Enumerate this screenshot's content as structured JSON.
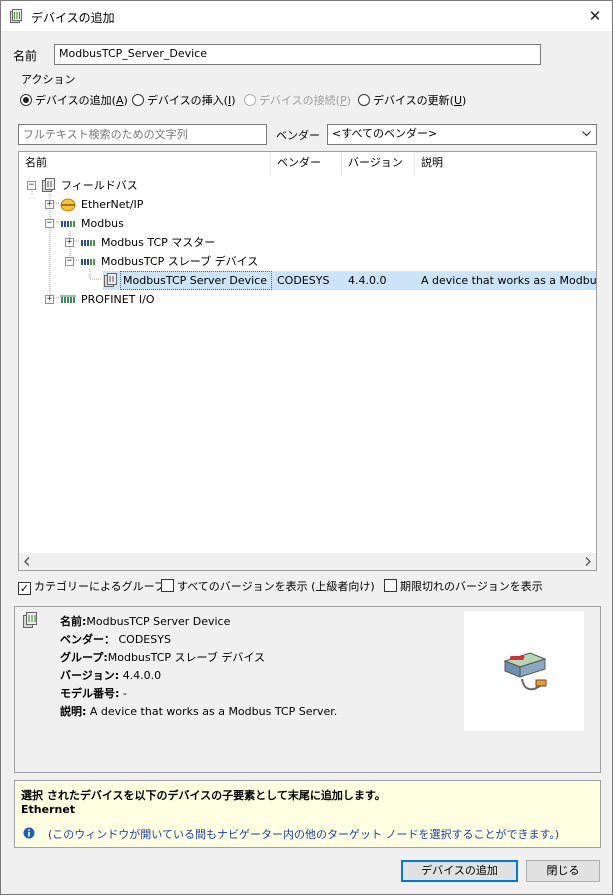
{
  "window": {
    "title": "デバイスの追加",
    "close_label": "✕"
  },
  "name_field": {
    "label": "名前",
    "value": "ModbusTCP_Server_Device"
  },
  "action": {
    "group_label": "アクション",
    "options": [
      {
        "label": "デバイスの追加(",
        "key": "A",
        "suffix": ")",
        "selected": true,
        "enabled": true
      },
      {
        "label": "デバイスの挿入(",
        "key": "I",
        "suffix": ")",
        "selected": false,
        "enabled": true
      },
      {
        "label": "デバイスの接続(",
        "key": "P",
        "suffix": ")",
        "selected": false,
        "enabled": false
      },
      {
        "label": "デバイスの更新(",
        "key": "U",
        "suffix": ")",
        "selected": false,
        "enabled": true
      }
    ]
  },
  "search": {
    "placeholder": "フルテキスト検索のための文字列"
  },
  "vendor": {
    "label": "ベンダー",
    "selected": "<すべてのベンダー>"
  },
  "grid": {
    "columns": [
      "名前",
      "ベンダー",
      "バージョン",
      "説明"
    ],
    "rows": [
      {
        "name": "フィールドバス",
        "expander": "−",
        "icon": "fieldbus-icon"
      },
      {
        "name": "EtherNet/IP",
        "expander": "+",
        "icon": "ethernet-ip-icon"
      },
      {
        "name": "Modbus",
        "expander": "−",
        "icon": "modbus-icon"
      },
      {
        "name": "Modbus TCP マスター",
        "expander": "+",
        "icon": "modbus-icon"
      },
      {
        "name": "ModbusTCP スレーブ デバイス",
        "expander": "−",
        "icon": "modbus-icon"
      },
      {
        "name": "ModbusTCP Server Device",
        "vendor": "CODESYS",
        "version": "4.4.0.0",
        "description": "A device that works as a Modbus TCP Server.",
        "icon": "device-icon",
        "selected": true
      },
      {
        "name": "PROFINET I/O",
        "expander": "+",
        "icon": "profinet-icon"
      }
    ]
  },
  "options": {
    "group_by_category": {
      "label": "カテゴリーによるグループ",
      "checked": true
    },
    "show_all_versions": {
      "label": "すべてのバージョンを表示 (上級者向け)",
      "checked": false
    },
    "show_outdated": {
      "label": "期限切れのバージョンを表示",
      "checked": false
    }
  },
  "info": {
    "name_label": "名前:",
    "name_value": "ModbusTCP Server Device",
    "vendor_label": "ベンダー：",
    "vendor_value": "CODESYS",
    "group_label": "グループ:",
    "group_value": "ModbusTCP スレーブ デバイス",
    "version_label": "バージョン:",
    "version_value": "4.4.0.0",
    "model_label": "モデル番号:",
    "model_value": "-",
    "desc_label": "説明:",
    "desc_value": "A device that works as a Modbus TCP Server."
  },
  "notice": {
    "heading": "選択 されたデバイスを以下のデバイスの子要素として末尾に追加します。",
    "target": "Ethernet",
    "hint": "(このウィンドウが開いている間もナビゲーター内の他のターゲット ノードを選択することができます。)"
  },
  "buttons": {
    "add": "デバイスの追加",
    "close": "閉じる"
  },
  "colors": {
    "selection": "#cce4f7",
    "notice_bg": "#ffffe1",
    "accent": "#0078d7"
  }
}
